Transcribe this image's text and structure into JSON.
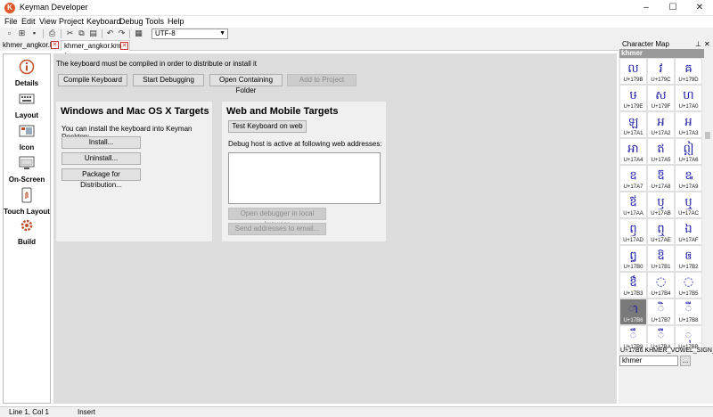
{
  "window": {
    "title": "Keyman Developer",
    "minimize": "–",
    "maximize": "☐",
    "close": "✕"
  },
  "menu": [
    "File",
    "Edit",
    "View",
    "Project",
    "Keyboard",
    "Debug",
    "Tools",
    "Help"
  ],
  "toolbar": {
    "encoding": "UTF-8"
  },
  "tabs": [
    {
      "label": "khmer_angkor.kpj"
    },
    {
      "label": "khmer_angkor.kmn *"
    }
  ],
  "sidebar": {
    "items": [
      {
        "label": "Details",
        "icon": "info-icon"
      },
      {
        "label": "Layout",
        "icon": "keyboard-layout-icon"
      },
      {
        "label": "Icon",
        "icon": "icon-editor-icon"
      },
      {
        "label": "On-Screen",
        "icon": "onscreen-keyboard-icon"
      },
      {
        "label": "Touch Layout",
        "icon": "touch-icon"
      },
      {
        "label": "Build",
        "icon": "gear-icon"
      }
    ],
    "selected": "Build"
  },
  "build": {
    "message": "The keyboard must be compiled in order to distribute or install it",
    "compile_label": "Compile Keyboard",
    "debug_label": "Start Debugging",
    "open_folder_label": "Open Containing Folder",
    "add_project_label": "Add to Project",
    "desktop": {
      "title": "Windows and Mac OS X Targets",
      "desc": "You can install the keyboard into Keyman Desktop:",
      "install_label": "Install...",
      "uninstall_label": "Uninstall...",
      "package_label": "Package for Distribution..."
    },
    "web": {
      "title": "Web and Mobile Targets",
      "test_label": "Test Keyboard on web",
      "hosts_label": "Debug host is active at following web addresses:",
      "open_debugger_label": "Open debugger in local browser",
      "send_email_label": "Send addresses to email..."
    }
  },
  "charmap": {
    "title": "Character Map",
    "filter_label": "khmer",
    "chars": [
      {
        "glyph": "ល",
        "code": "U+179B"
      },
      {
        "glyph": "វ",
        "code": "U+179C"
      },
      {
        "glyph": "ឝ",
        "code": "U+179D"
      },
      {
        "glyph": "ឞ",
        "code": "U+179E"
      },
      {
        "glyph": "ស",
        "code": "U+179F"
      },
      {
        "glyph": "ហ",
        "code": "U+17A0"
      },
      {
        "glyph": "ឡ",
        "code": "U+17A1"
      },
      {
        "glyph": "អ",
        "code": "U+17A2"
      },
      {
        "glyph": "ឣ",
        "code": "U+17A3"
      },
      {
        "glyph": "ឤ",
        "code": "U+17A4"
      },
      {
        "glyph": "ឥ",
        "code": "U+17A5"
      },
      {
        "glyph": "ឦ",
        "code": "U+17A6"
      },
      {
        "glyph": "ឧ",
        "code": "U+17A7"
      },
      {
        "glyph": "ឨ",
        "code": "U+17A8"
      },
      {
        "glyph": "ឩ",
        "code": "U+17A9"
      },
      {
        "glyph": "ឪ",
        "code": "U+17AA"
      },
      {
        "glyph": "ឫ",
        "code": "U+17AB"
      },
      {
        "glyph": "ឬ",
        "code": "U+17AC"
      },
      {
        "glyph": "ឭ",
        "code": "U+17AD"
      },
      {
        "glyph": "ឮ",
        "code": "U+17AE"
      },
      {
        "glyph": "ឯ",
        "code": "U+17AF"
      },
      {
        "glyph": "ឰ",
        "code": "U+17B0"
      },
      {
        "glyph": "ឱ",
        "code": "U+17B1"
      },
      {
        "glyph": "ឲ",
        "code": "U+17B2"
      },
      {
        "glyph": "ឳ",
        "code": "U+17B3"
      },
      {
        "glyph": "◌឴",
        "code": "U+17B4"
      },
      {
        "glyph": "◌឵",
        "code": "U+17B5"
      },
      {
        "glyph": "◌ា",
        "code": "U+17B6"
      },
      {
        "glyph": "◌ិ",
        "code": "U+17B7"
      },
      {
        "glyph": "◌ី",
        "code": "U+17B8"
      },
      {
        "glyph": "◌ឹ",
        "code": "U+17B9"
      },
      {
        "glyph": "◌ឺ",
        "code": "U+17BA"
      },
      {
        "glyph": "◌ុ",
        "code": "U+17BB"
      }
    ],
    "selected_code": "U+17B6",
    "selected_name": "U+17B6 KHMER_VOWEL_SIGN_AA",
    "search_value": "khmer",
    "browse_label": "..."
  },
  "status": {
    "position": "Line 1, Col 1",
    "mode": "Insert"
  }
}
